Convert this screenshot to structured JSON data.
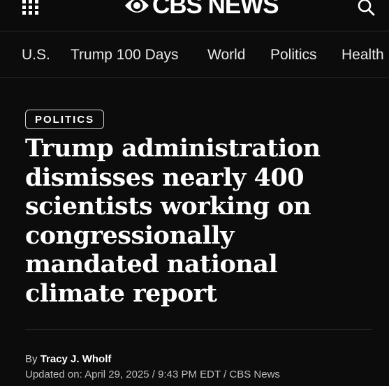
{
  "header": {
    "logo_text": "CBS NEWS",
    "menu_icon": "grid-menu-icon",
    "search_icon": "search-icon"
  },
  "nav": {
    "items": [
      {
        "label": "U.S."
      },
      {
        "label": "Trump 100 Days"
      },
      {
        "label": "World"
      },
      {
        "label": "Politics"
      },
      {
        "label": "Health"
      }
    ]
  },
  "article": {
    "section": "POLITICS",
    "headline": "Trump administration dismisses nearly 400 scientists working on congressionally mandated national climate report",
    "byline_prefix": "By",
    "author": "Tracy J. Wholf",
    "dateline": "Updated on: April 29, 2025 / 9:43 PM EDT / CBS News"
  },
  "colors": {
    "background": "#0c0c0c",
    "text": "#ffffff",
    "muted": "#bdbdbd"
  }
}
